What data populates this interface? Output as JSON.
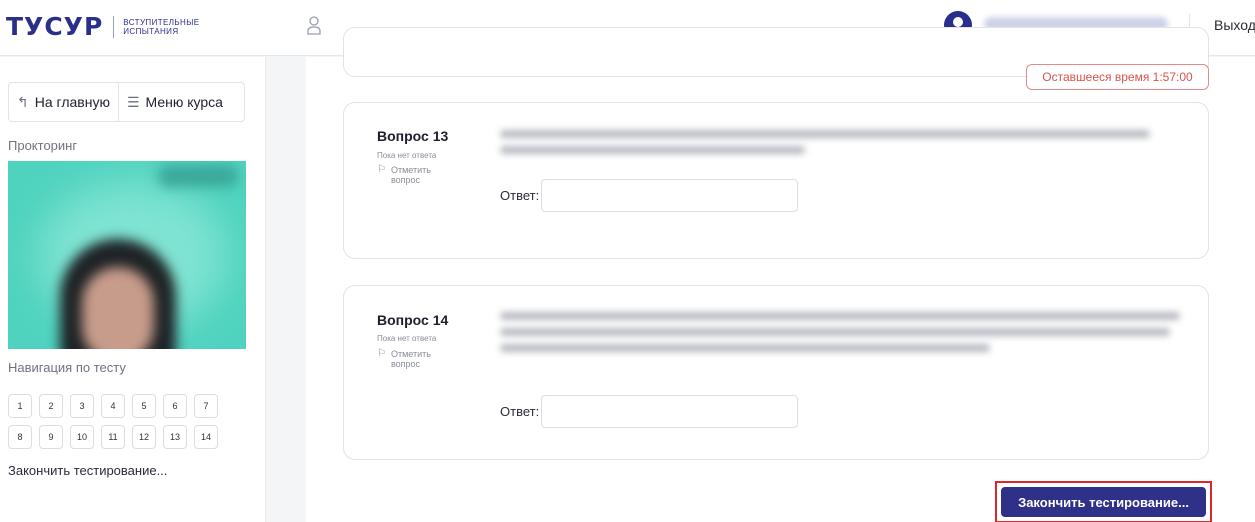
{
  "header": {
    "logo": "ТУСУР",
    "logo_sub_line1": "ВСТУПИТЕЛЬНЫЕ",
    "logo_sub_line2": "ИСПЫТАНИЯ",
    "logout": "Выход"
  },
  "sidebar": {
    "home_button": "На главную",
    "course_menu_button": "Меню курса",
    "proctoring_label": "Прокторинг",
    "test_navigation_label": "Навигация по тесту",
    "question_numbers": [
      [
        "1",
        "2",
        "3",
        "4",
        "5",
        "6",
        "7"
      ],
      [
        "8",
        "9",
        "10",
        "11",
        "12",
        "13",
        "14"
      ]
    ],
    "finish_link": "Закончить тестирование..."
  },
  "main": {
    "timer": "Оставшееся время 1:57:00",
    "questions": [
      {
        "title": "Вопрос 13",
        "status": "Пока нет ответа",
        "flag": "Отметить вопрос",
        "answer_label": "Ответ:",
        "answer_value": ""
      },
      {
        "title": "Вопрос 14",
        "status": "Пока нет ответа",
        "flag": "Отметить вопрос",
        "answer_label": "Ответ:",
        "answer_value": ""
      }
    ],
    "finish_button": "Закончить тестирование..."
  },
  "colors": {
    "brand": "#2a2f8a",
    "button_bg": "#2f3088",
    "timer_red": "#d9534f",
    "highlight_red": "#e0262a"
  }
}
